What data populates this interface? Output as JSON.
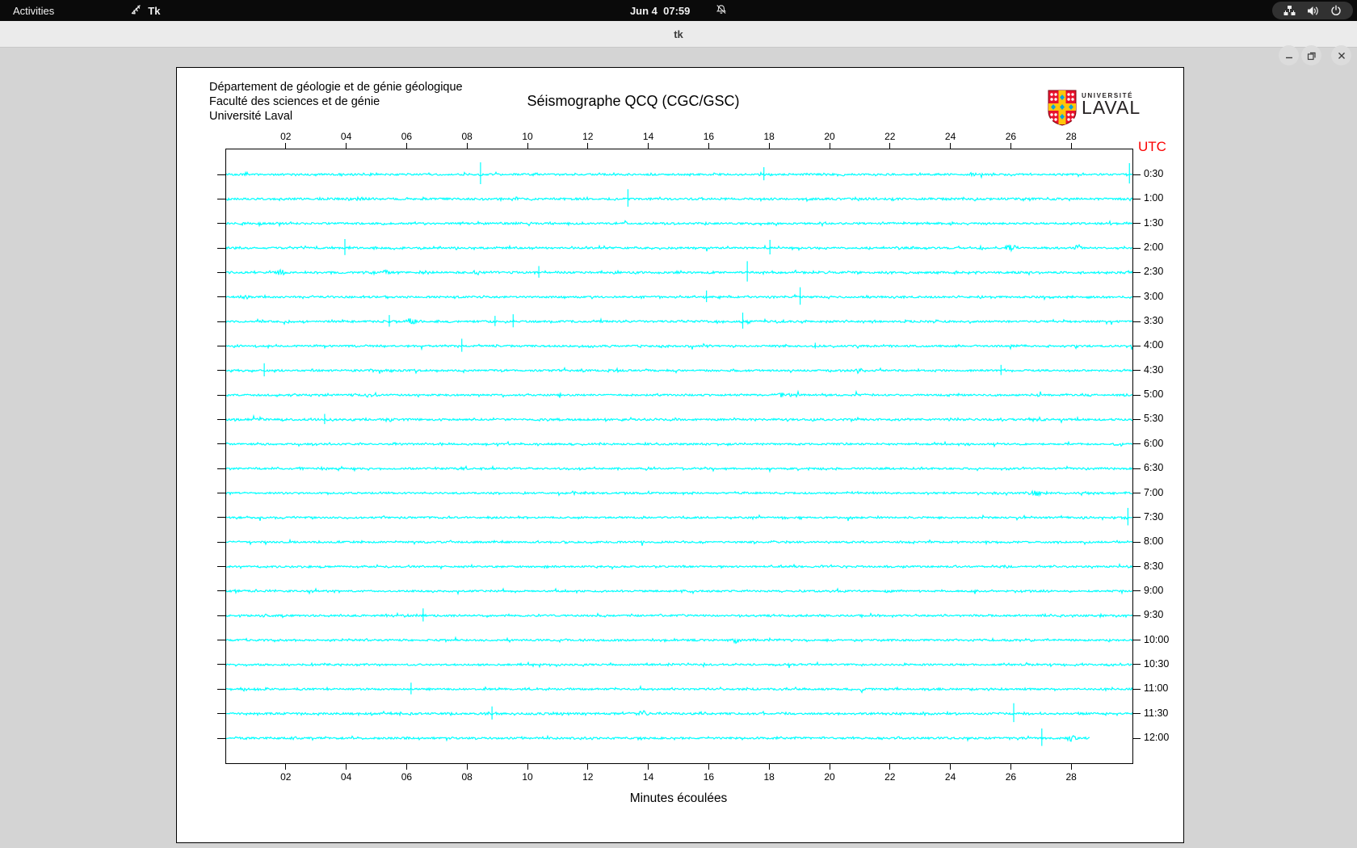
{
  "topbar": {
    "activities": "Activities",
    "app_name": "Tk",
    "clock": "Jun 4  07:59"
  },
  "titlebar": {
    "title": "tk"
  },
  "panel": {
    "dept_lines": [
      "Département de géologie et de génie géologique",
      "Faculté des sciences et de génie",
      "Université Laval"
    ],
    "title": "Séismographe QCQ (CGC/GSC)",
    "utc_label": "UTC",
    "utc_color": "#fb0000",
    "xaxis_title": "Minutes écoulées",
    "logo": {
      "line1": "UNIVERSITÉ",
      "line2": "LAVAL",
      "shield_red": "#e8112d",
      "shield_gold": "#ffc60a",
      "shield_blue": "#0aa2dc"
    }
  },
  "chart_data": {
    "type": "line",
    "title": "Séismographe QCQ (CGC/GSC)",
    "xlabel": "Minutes écoulées",
    "x_ticks": [
      "02",
      "04",
      "06",
      "08",
      "10",
      "12",
      "14",
      "16",
      "18",
      "20",
      "22",
      "24",
      "26",
      "28"
    ],
    "x_range_minutes": [
      0,
      30
    ],
    "minutes_per_row": 30,
    "trace_color": "#00ffff",
    "grid": false,
    "rows": [
      {
        "utc": "0:30",
        "na": 1.0,
        "events": [
          {
            "t": "spike",
            "m": 8.42,
            "a": 15
          },
          {
            "t": "burst",
            "m": 10.2,
            "a": 3,
            "w": 16
          },
          {
            "t": "spike",
            "m": 17.8,
            "a": 9
          },
          {
            "t": "burst",
            "m": 24.7,
            "a": 2.5,
            "w": 12
          },
          {
            "t": "spike",
            "m": 29.9,
            "a": 14
          }
        ]
      },
      {
        "utc": "1:00",
        "na": 1.15,
        "events": [
          {
            "t": "spike",
            "m": 13.3,
            "a": 12
          }
        ]
      },
      {
        "utc": "1:30",
        "na": 1.0,
        "events": []
      },
      {
        "utc": "2:00",
        "na": 1.0,
        "events": [
          {
            "t": "spike",
            "m": 3.93,
            "a": 11
          },
          {
            "t": "spike",
            "m": 18.0,
            "a": 10
          },
          {
            "t": "burst",
            "m": 25.0,
            "a": 2.5,
            "w": 10
          },
          {
            "t": "burst",
            "m": 26.0,
            "a": 4,
            "w": 22
          },
          {
            "t": "burst",
            "m": 28.2,
            "a": 4,
            "w": 14
          }
        ]
      },
      {
        "utc": "2:30",
        "na": 1.1,
        "events": [
          {
            "t": "burst",
            "m": 1.8,
            "a": 3.5,
            "w": 18
          },
          {
            "t": "burst",
            "m": 5.3,
            "a": 3,
            "w": 14
          },
          {
            "t": "burst",
            "m": 8.3,
            "a": 3,
            "w": 14
          },
          {
            "t": "spike",
            "m": 10.35,
            "a": 8
          },
          {
            "t": "spike",
            "m": 17.25,
            "a": 14
          }
        ]
      },
      {
        "utc": "3:00",
        "na": 1.0,
        "events": [
          {
            "t": "burst",
            "m": 0.6,
            "a": 3,
            "w": 18
          },
          {
            "t": "spike",
            "m": 15.9,
            "a": 8
          },
          {
            "t": "spike",
            "m": 19.0,
            "a": 12
          }
        ]
      },
      {
        "utc": "3:30",
        "na": 1.05,
        "events": [
          {
            "t": "spike",
            "m": 5.4,
            "a": 8
          },
          {
            "t": "burst",
            "m": 6.1,
            "a": 4.5,
            "w": 20
          },
          {
            "t": "spike",
            "m": 8.9,
            "a": 7
          },
          {
            "t": "spike",
            "m": 9.5,
            "a": 9
          },
          {
            "t": "spike",
            "m": 17.1,
            "a": 11
          }
        ]
      },
      {
        "utc": "4:00",
        "na": 1.0,
        "events": [
          {
            "t": "spike",
            "m": 7.8,
            "a": 9
          },
          {
            "t": "spike",
            "m": 19.5,
            "a": 4
          }
        ]
      },
      {
        "utc": "4:30",
        "na": 1.0,
        "events": [
          {
            "t": "spike",
            "m": 1.26,
            "a": 9
          },
          {
            "t": "burst",
            "m": 20.9,
            "a": 3.5,
            "w": 16
          },
          {
            "t": "spike",
            "m": 25.65,
            "a": 7
          }
        ]
      },
      {
        "utc": "5:00",
        "na": 1.0,
        "events": [
          {
            "t": "burst",
            "m": 18.4,
            "a": 3,
            "w": 14
          }
        ]
      },
      {
        "utc": "5:30",
        "na": 1.1,
        "events": [
          {
            "t": "burst",
            "m": 1.1,
            "a": 3,
            "w": 12
          },
          {
            "t": "spike",
            "m": 3.26,
            "a": 7
          },
          {
            "t": "burst",
            "m": 5.4,
            "a": 3.5,
            "w": 16
          }
        ]
      },
      {
        "utc": "6:00",
        "na": 0.95,
        "events": []
      },
      {
        "utc": "6:30",
        "na": 0.95,
        "events": []
      },
      {
        "utc": "7:00",
        "na": 0.95,
        "events": [
          {
            "t": "burst",
            "m": 26.8,
            "a": 3.5,
            "w": 18
          }
        ]
      },
      {
        "utc": "7:30",
        "na": 0.95,
        "events": [
          {
            "t": "spike",
            "m": 29.85,
            "a": 12
          }
        ]
      },
      {
        "utc": "8:00",
        "na": 0.95,
        "events": []
      },
      {
        "utc": "8:30",
        "na": 0.95,
        "events": []
      },
      {
        "utc": "9:00",
        "na": 0.95,
        "events": []
      },
      {
        "utc": "9:30",
        "na": 1.0,
        "events": [
          {
            "t": "spike",
            "m": 6.52,
            "a": 9
          }
        ]
      },
      {
        "utc": "10:00",
        "na": 1.0,
        "events": [
          {
            "t": "burst",
            "m": 16.85,
            "a": 4,
            "w": 14
          }
        ]
      },
      {
        "utc": "10:30",
        "na": 0.95,
        "events": []
      },
      {
        "utc": "11:00",
        "na": 1.0,
        "events": [
          {
            "t": "spike",
            "m": 6.12,
            "a": 8
          }
        ]
      },
      {
        "utc": "11:30",
        "na": 1.1,
        "events": [
          {
            "t": "spike",
            "m": 8.8,
            "a": 9
          },
          {
            "t": "burst",
            "m": 13.8,
            "a": 4,
            "w": 16
          },
          {
            "t": "spike",
            "m": 26.07,
            "a": 13
          }
        ]
      },
      {
        "utc": "12:00",
        "na": 1.05,
        "end_minute": 28.6,
        "events": [
          {
            "t": "spike",
            "m": 27.0,
            "a": 12
          },
          {
            "t": "burst",
            "m": 28.0,
            "a": 4,
            "w": 18
          }
        ]
      }
    ]
  }
}
